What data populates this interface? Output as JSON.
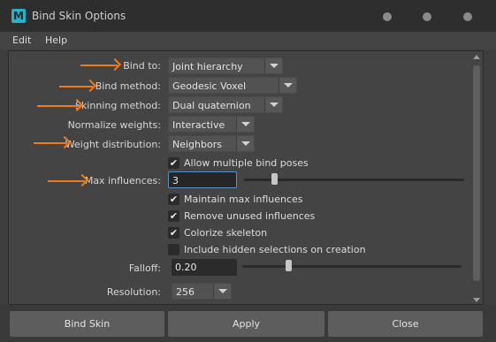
{
  "window": {
    "title": "Bind Skin Options",
    "app_icon_letter": "M"
  },
  "menu": {
    "items": [
      "Edit",
      "Help"
    ]
  },
  "options": {
    "bind_to": {
      "label": "Bind to:",
      "value": "Joint hierarchy"
    },
    "bind_method": {
      "label": "Bind method:",
      "value": "Geodesic Voxel"
    },
    "skinning_method": {
      "label": "Skinning method:",
      "value": "Dual quaternion"
    },
    "normalize_weights": {
      "label": "Normalize weights:",
      "value": "Interactive"
    },
    "weight_distribution": {
      "label": "Weight distribution:",
      "value": "Neighbors"
    },
    "allow_multiple_bind_poses": {
      "label": "Allow multiple bind poses",
      "checked": true
    },
    "max_influences": {
      "label": "Max influences:",
      "value": "3"
    },
    "maintain_max_influences": {
      "label": "Maintain max influences",
      "checked": true
    },
    "remove_unused_influences": {
      "label": "Remove unused influences",
      "checked": true
    },
    "colorize_skeleton": {
      "label": "Colorize skeleton",
      "checked": true
    },
    "include_hidden_selections": {
      "label": "Include hidden selections on creation",
      "checked": false
    },
    "falloff": {
      "label": "Falloff:",
      "value": "0.20"
    },
    "resolution": {
      "label": "Resolution:",
      "value": "256"
    }
  },
  "checkmark_glyph": "✔",
  "buttons": {
    "bind_skin": "Bind Skin",
    "apply": "Apply",
    "close": "Close"
  },
  "colors": {
    "annotation": "#f07a1a",
    "accent_focus": "#5a8fc4"
  }
}
